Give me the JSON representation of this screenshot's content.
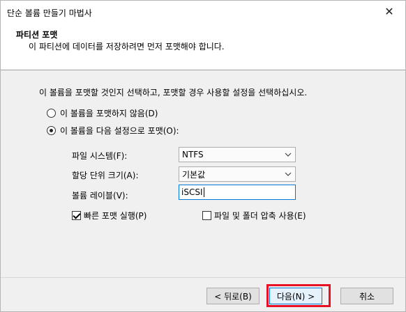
{
  "window": {
    "title": "단순 볼륨 만들기 마법사",
    "close_glyph": "✕"
  },
  "header": {
    "title": "파티션 포맷",
    "subtitle": "이 파티션에 데이터를 저장하려면 먼저 포맷해야 합니다."
  },
  "content": {
    "instruction": "이 볼륨을 포맷할 것인지 선택하고, 포맷할 경우 사용할 설정을 선택하십시오.",
    "radio_no_format": {
      "label": "이 볼륨을 포맷하지 않음(D)",
      "checked": false
    },
    "radio_format": {
      "label": "이 볼륨을 다음 설정으로 포맷(O):",
      "checked": true
    },
    "file_system": {
      "label": "파일 시스템(F):",
      "value": "NTFS"
    },
    "allocation_unit": {
      "label": "할당 단위 크기(A):",
      "value": "기본값"
    },
    "volume_label": {
      "label": "볼륨 레이블(V):",
      "value": "iSCSI"
    },
    "quick_format": {
      "label": "빠른 포맷 실행(P)",
      "checked": true
    },
    "compression": {
      "label": "파일 및 폴더 압축 사용(E)",
      "checked": false
    }
  },
  "buttons": {
    "back": "< 뒤로(B)",
    "next": "다음(N) >",
    "cancel": "취소"
  },
  "colors": {
    "accent": "#0078d7",
    "highlight": "#e81123"
  }
}
